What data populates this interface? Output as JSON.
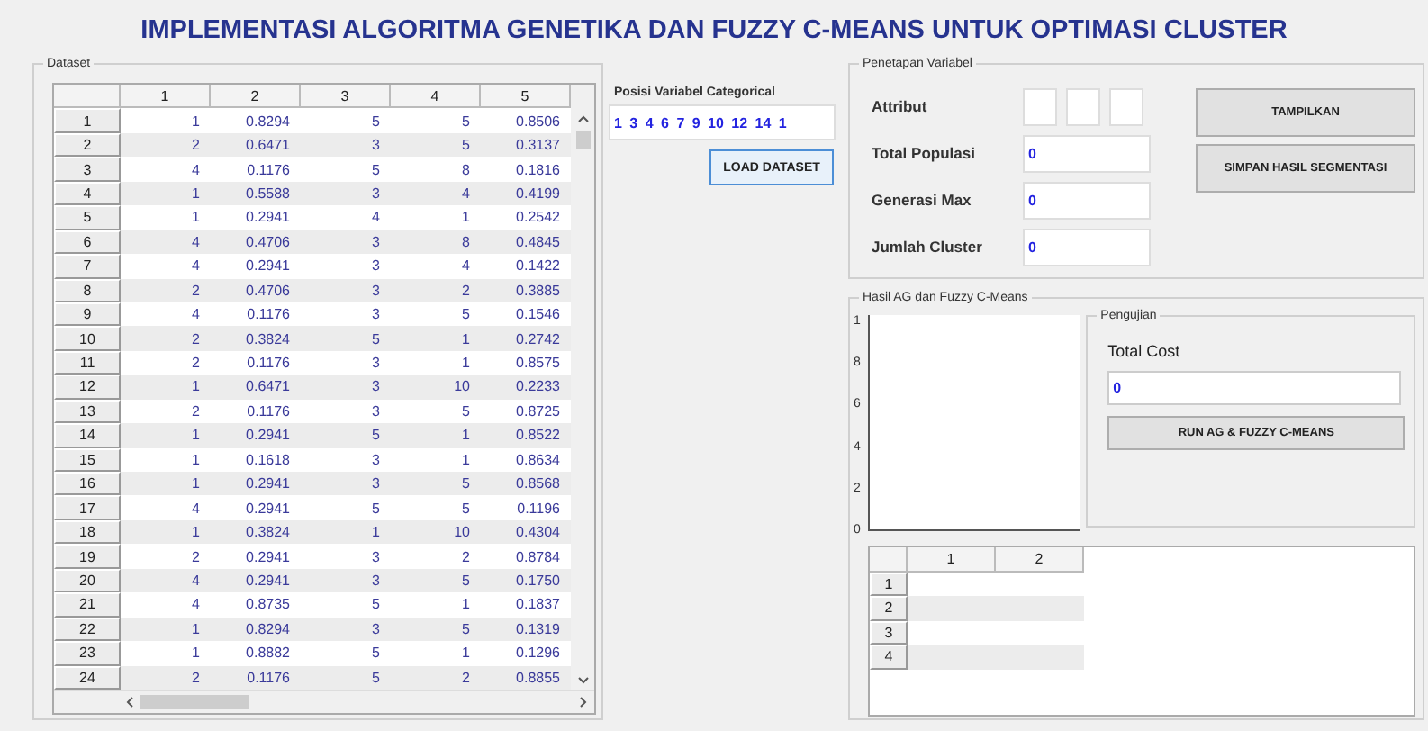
{
  "title": "IMPLEMENTASI ALGORITMA GENETIKA DAN FUZZY C-MEANS UNTUK OPTIMASI CLUSTER",
  "dataset": {
    "label": "Dataset",
    "columns": [
      "1",
      "2",
      "3",
      "4",
      "5"
    ],
    "rows": [
      {
        "header": "1",
        "cells": [
          "1",
          "0.8294",
          "5",
          "5",
          "0.8506"
        ]
      },
      {
        "header": "2",
        "cells": [
          "2",
          "0.6471",
          "3",
          "5",
          "0.3137"
        ]
      },
      {
        "header": "3",
        "cells": [
          "4",
          "0.1176",
          "5",
          "8",
          "0.1816"
        ]
      },
      {
        "header": "4",
        "cells": [
          "1",
          "0.5588",
          "3",
          "4",
          "0.4199"
        ]
      },
      {
        "header": "5",
        "cells": [
          "1",
          "0.2941",
          "4",
          "1",
          "0.2542"
        ]
      },
      {
        "header": "6",
        "cells": [
          "4",
          "0.4706",
          "3",
          "8",
          "0.4845"
        ]
      },
      {
        "header": "7",
        "cells": [
          "4",
          "0.2941",
          "3",
          "4",
          "0.1422"
        ]
      },
      {
        "header": "8",
        "cells": [
          "2",
          "0.4706",
          "3",
          "2",
          "0.3885"
        ]
      },
      {
        "header": "9",
        "cells": [
          "4",
          "0.1176",
          "3",
          "5",
          "0.1546"
        ]
      },
      {
        "header": "10",
        "cells": [
          "2",
          "0.3824",
          "5",
          "1",
          "0.2742"
        ]
      },
      {
        "header": "11",
        "cells": [
          "2",
          "0.1176",
          "3",
          "1",
          "0.8575"
        ]
      },
      {
        "header": "12",
        "cells": [
          "1",
          "0.6471",
          "3",
          "10",
          "0.2233"
        ]
      },
      {
        "header": "13",
        "cells": [
          "2",
          "0.1176",
          "3",
          "5",
          "0.8725"
        ]
      },
      {
        "header": "14",
        "cells": [
          "1",
          "0.2941",
          "5",
          "1",
          "0.8522"
        ]
      },
      {
        "header": "15",
        "cells": [
          "1",
          "0.1618",
          "3",
          "1",
          "0.8634"
        ]
      },
      {
        "header": "16",
        "cells": [
          "1",
          "0.2941",
          "3",
          "5",
          "0.8568"
        ]
      },
      {
        "header": "17",
        "cells": [
          "4",
          "0.2941",
          "5",
          "5",
          "0.1196"
        ]
      },
      {
        "header": "18",
        "cells": [
          "1",
          "0.3824",
          "1",
          "10",
          "0.4304"
        ]
      },
      {
        "header": "19",
        "cells": [
          "2",
          "0.2941",
          "3",
          "2",
          "0.8784"
        ]
      },
      {
        "header": "20",
        "cells": [
          "4",
          "0.2941",
          "3",
          "5",
          "0.1750"
        ]
      },
      {
        "header": "21",
        "cells": [
          "4",
          "0.8735",
          "5",
          "1",
          "0.1837"
        ]
      },
      {
        "header": "22",
        "cells": [
          "1",
          "0.8294",
          "3",
          "5",
          "0.1319"
        ]
      },
      {
        "header": "23",
        "cells": [
          "1",
          "0.8882",
          "5",
          "1",
          "0.1296"
        ]
      },
      {
        "header": "24",
        "cells": [
          "2",
          "0.1176",
          "5",
          "2",
          "0.8855"
        ]
      }
    ]
  },
  "categorical": {
    "label": "Posisi Variabel Categorical",
    "value": "1 3 4 6 7 9 10 12 14 1",
    "button": "LOAD DATASET"
  },
  "penetapan": {
    "label": "Penetapan Variabel",
    "fields": [
      {
        "kind": "boxes",
        "label": "Attribut"
      },
      {
        "kind": "text",
        "label": "Total Populasi",
        "value": "0"
      },
      {
        "kind": "text",
        "label": "Generasi Max",
        "value": "0"
      },
      {
        "kind": "text",
        "label": "Jumlah Cluster",
        "value": "0"
      }
    ],
    "buttons": [
      "TAMPILKAN",
      "SIMPAN HASIL SEGMENTASI"
    ]
  },
  "hasil": {
    "label": "Hasil AG dan Fuzzy C-Means",
    "plot": {
      "yticks": [
        "1",
        "8",
        "6",
        "4",
        "2",
        "0"
      ]
    },
    "pengujian": {
      "label": "Pengujian",
      "cost_label": "Total Cost",
      "cost_value": "0",
      "button": "RUN AG & FUZZY C-MEANS"
    },
    "result_table": {
      "columns": [
        "1",
        "2"
      ],
      "rows": [
        "1",
        "2",
        "3",
        "4"
      ]
    }
  }
}
